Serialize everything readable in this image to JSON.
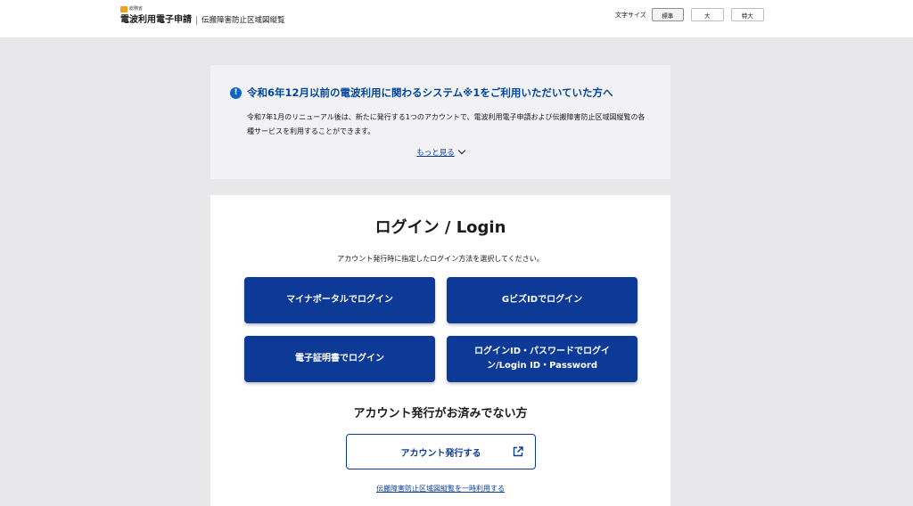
{
  "header": {
    "logo_ministry": "総務省",
    "logo_title": "電波利用電子申請",
    "logo_subtitle": "伝搬障害防止区域図縦覧",
    "font_size_label": "文字サイズ",
    "font_size_options": [
      "標準",
      "大",
      "特大"
    ],
    "font_size_selected": "標準"
  },
  "notice": {
    "icon": "info-exclamation-icon",
    "title": "令和6年12月以前の電波利用に関わるシステム※1をご利用いただいていた方へ",
    "body": "令和7年1月のリニューアル後は、新たに発行する1つのアカウントで、電波利用電子申請および伝搬障害防止区域図縦覧の各種サービスを利用することができます。",
    "more_label": "もっと見る"
  },
  "login": {
    "title": "ログイン / Login",
    "description": "アカウント発行時に指定したログイン方法を選択してください。",
    "buttons": [
      "マイナポータルでログイン",
      "GビズIDでログイン",
      "電子証明書でログイン",
      "ログインID・パスワードでログイン/Login ID・Password"
    ],
    "no_account_title": "アカウント発行がお済みでない方",
    "issue_account_label": "アカウント発行する",
    "temp_use_link": "伝搬障害防止区域図縦覧を一時利用する"
  },
  "colors": {
    "primary": "#0d3a97",
    "notice_title": "#00479d",
    "info_icon": "#0f66c0",
    "logo_accent": "#f0a11a",
    "background": "#e8e8ea"
  }
}
